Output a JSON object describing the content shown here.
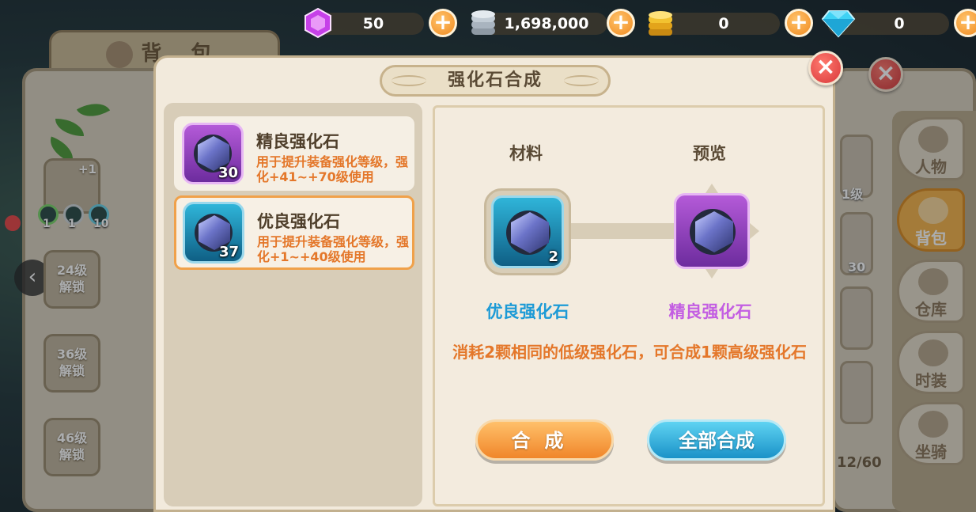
{
  "currencies": [
    {
      "name": "purple-gem",
      "value": "50",
      "color": "#c640e8"
    },
    {
      "name": "silver-coins",
      "value": "1,698,000",
      "color": "#b9c4cf"
    },
    {
      "name": "gold-coins",
      "value": "0",
      "color": "#f2c230"
    },
    {
      "name": "diamond",
      "value": "0",
      "color": "#3fd2f4"
    }
  ],
  "background": {
    "backpack_tab": "背 包",
    "plus_label": "+1",
    "mini_counts": [
      "1",
      "1",
      "10"
    ],
    "locked_slots": [
      {
        "line1": "24级",
        "line2": "解锁"
      },
      {
        "line1": "36级",
        "line2": "解锁"
      },
      {
        "line1": "46级",
        "line2": "解锁"
      }
    ],
    "right_tabs": [
      "人物",
      "背包",
      "仓库",
      "时装",
      "坐骑"
    ],
    "right_level": "1级",
    "right_count": "30",
    "capacity": "12/60"
  },
  "dialog": {
    "title": "强化石合成",
    "items": [
      {
        "name": "精良强化石",
        "desc": "用于提升装备强化等级，强化+41~+70级使用",
        "count": "30",
        "rarity": "purple"
      },
      {
        "name": "优良强化石",
        "desc": "用于提升装备强化等级，强化+1~+40级使用",
        "count": "37",
        "rarity": "blue"
      }
    ],
    "material_label": "材料",
    "preview_label": "预览",
    "material": {
      "name": "优良强化石",
      "count": "2"
    },
    "preview": {
      "name": "精良强化石"
    },
    "hint": "消耗2颗相同的低级强化石，可合成1颗高级强化石",
    "synth_button": "合成",
    "synth_all_button": "全部合成"
  },
  "colors": {
    "accent_orange": "#f0862a",
    "accent_blue": "#1a92c8",
    "text_orange": "#e4772a",
    "name_blue": "#1c9ad6",
    "name_purple": "#c35ee2"
  }
}
